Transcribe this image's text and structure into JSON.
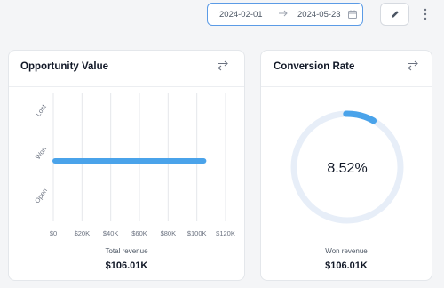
{
  "toolbar": {
    "start_date": "2024-02-01",
    "end_date": "2024-05-23",
    "arrow_icon": "arrow-right-icon",
    "calendar_icon": "calendar-icon",
    "edit_icon": "pencil-icon",
    "more_icon": "more-vertical-icon"
  },
  "opportunity_card": {
    "title": "Opportunity Value",
    "settings_icon": "sliders-icon",
    "caption": "Total revenue",
    "value": "$106.01K"
  },
  "conversion_card": {
    "title": "Conversion Rate",
    "settings_icon": "sliders-icon",
    "percent_label": "8.52%",
    "caption": "Won revenue",
    "value": "$106.01K"
  },
  "colors": {
    "accent": "#4aa3ea",
    "gauge_track": "#e7eef8",
    "grid": "#e5e7eb"
  },
  "chart_data": [
    {
      "type": "bar",
      "orientation": "horizontal",
      "categories": [
        "Lost",
        "Won",
        "Open"
      ],
      "values": [
        0,
        106010,
        0
      ],
      "x_ticks": [
        "$0",
        "$20K",
        "$40K",
        "$60K",
        "$80K",
        "$100K",
        "$120K"
      ],
      "xlim": [
        0,
        120000
      ],
      "grid": true,
      "color": "#4aa3ea"
    },
    {
      "type": "pie",
      "style": "donut-gauge",
      "values": [
        8.52,
        91.48
      ],
      "color": "#4aa3ea"
    }
  ]
}
